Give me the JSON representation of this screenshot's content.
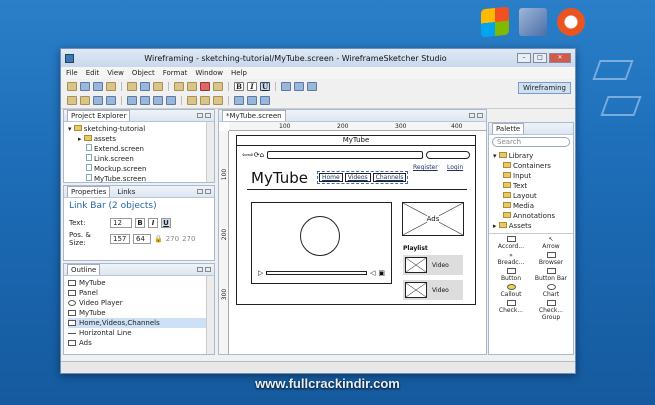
{
  "window": {
    "title": "Wireframing - sketching-tutorial/MyTube.screen - WireframeSketcher Studio"
  },
  "menu": [
    "File",
    "Edit",
    "View",
    "Object",
    "Format",
    "Window",
    "Help"
  ],
  "toolbar": {
    "badge": "Wireframing",
    "bold": "B",
    "italic": "I",
    "underline": "U"
  },
  "project_explorer": {
    "title": "Project Explorer",
    "items": [
      "sketching-tutorial",
      "assets",
      "Extend.screen",
      "Link.screen",
      "Mockup.screen",
      "MyTube.screen"
    ]
  },
  "properties": {
    "tab1": "Properties",
    "tab2": "Links",
    "heading": "Link Bar (2 objects)",
    "text_label": "Text:",
    "font_size": "12",
    "pos_label": "Pos. & Size:",
    "x": "157",
    "y": "64",
    "w": "270",
    "h": "270"
  },
  "outline": {
    "title": "Outline",
    "items": [
      "MyTube",
      "Panel",
      "Video Player",
      "MyTube",
      "Home,Videos,Channels",
      "Horizontal Line",
      "Ads"
    ]
  },
  "editor": {
    "tab": "*MyTube.screen",
    "ruler_top": [
      "100",
      "200",
      "300",
      "400"
    ],
    "ruler_left": [
      "100",
      "200",
      "300"
    ],
    "sketch_title": "MyTube",
    "brand": "MyTube",
    "nav": [
      "Home",
      "Videos",
      "Channels"
    ],
    "register": "Register",
    "login": "Login",
    "ads": "Ads",
    "playlist": "Playlist",
    "video_label": "Video"
  },
  "palette": {
    "title": "Palette",
    "search_placeholder": "Search",
    "tree": [
      "Library",
      "Containers",
      "Input",
      "Text",
      "Layout",
      "Media",
      "Annotations",
      "Assets"
    ],
    "items": [
      "Accord...",
      "Arrow",
      "Breadc...",
      "Browser",
      "Button",
      "Button Bar",
      "Callout",
      "Chart",
      "Check...",
      "Check... Group"
    ]
  },
  "watermark": "www.fullcrackindir.com"
}
